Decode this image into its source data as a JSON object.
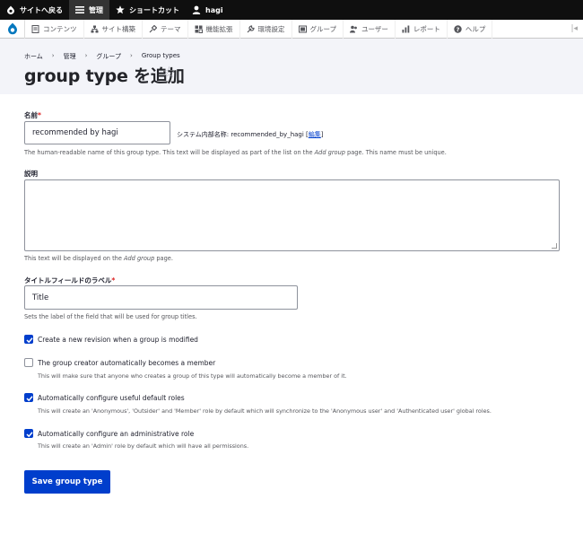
{
  "toolbar": {
    "back_label": "サイトへ戻る",
    "manage_label": "管理",
    "shortcuts_label": "ショートカット",
    "user_label": "hagi"
  },
  "tray": {
    "items": [
      {
        "label": "コンテンツ",
        "icon": "content-icon"
      },
      {
        "label": "サイト構築",
        "icon": "structure-icon"
      },
      {
        "label": "テーマ",
        "icon": "appearance-icon"
      },
      {
        "label": "機能拡張",
        "icon": "extend-icon"
      },
      {
        "label": "環境設定",
        "icon": "config-icon"
      },
      {
        "label": "グループ",
        "icon": "group-icon"
      },
      {
        "label": "ユーザー",
        "icon": "people-icon"
      },
      {
        "label": "レポート",
        "icon": "reports-icon"
      },
      {
        "label": "ヘルプ",
        "icon": "help-icon"
      }
    ]
  },
  "breadcrumb": [
    "ホーム",
    "管理",
    "グループ",
    "Group types"
  ],
  "page_title": "group type を追加",
  "form": {
    "name_label": "名前",
    "name_value": "recommended by hagi",
    "machine_name_prefix": "システム内部名称: recommended_by_hagi [",
    "machine_name_link": "編集",
    "machine_name_suffix": "]",
    "name_desc_before": "The human-readable name of this group type. This text will be displayed as part of the list on the ",
    "name_desc_em": "Add group",
    "name_desc_after": " page. This name must be unique.",
    "description_label": "説明",
    "description_desc_before": "This text will be displayed on the ",
    "description_desc_em": "Add group",
    "description_desc_after": " page.",
    "title_label": "タイトルフィールドのラベル",
    "title_value": "Title",
    "title_desc": "Sets the label of the field that will be used for group titles.",
    "checkboxes": [
      {
        "label": "Create a new revision when a group is modified",
        "checked": true,
        "desc": ""
      },
      {
        "label": "The group creator automatically becomes a member",
        "checked": false,
        "desc": "This will make sure that anyone who creates a group of this type will automatically become a member of it."
      },
      {
        "label": "Automatically configure useful default roles",
        "checked": true,
        "desc": "This will create an 'Anonymous', 'Outsider' and 'Member' role by default which will synchronize to the 'Anonymous user' and 'Authenticated user' global roles."
      },
      {
        "label": "Automatically configure an administrative role",
        "checked": true,
        "desc": "This will create an 'Admin' role by default which will have all permissions."
      }
    ],
    "save_label": "Save group type"
  },
  "colors": {
    "accent": "#003ecc",
    "required": "#dc2323",
    "toolbar": "#0f0f0f",
    "header_bg": "#f3f4f9"
  }
}
